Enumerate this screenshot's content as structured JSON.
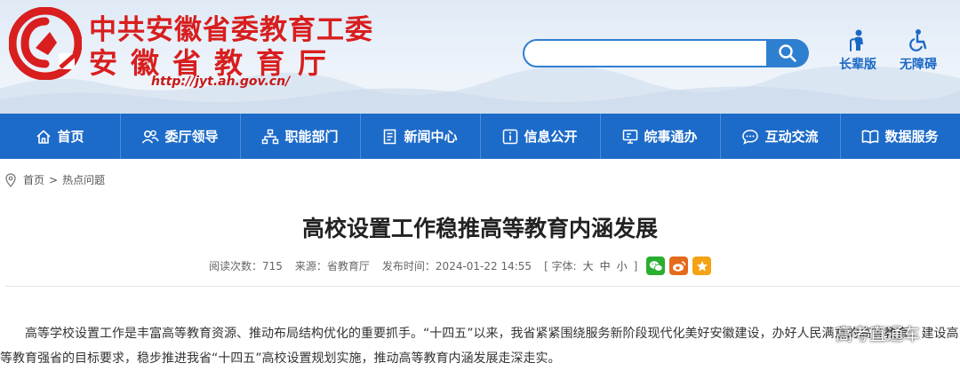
{
  "header": {
    "title_line1": "中共安徽省委教育工委",
    "title_line2": "安徽省教育厅",
    "url": "http://jyt.ah.gov.cn/",
    "search": {
      "value": "",
      "placeholder": ""
    },
    "quick_links": [
      {
        "label": "长辈版",
        "icon": "elder-person-icon"
      },
      {
        "label": "无障碍",
        "icon": "wheelchair-icon"
      }
    ],
    "colors": {
      "title_red": "#d81e1e",
      "nav_blue": "#1d6bc9"
    }
  },
  "nav": {
    "items": [
      {
        "label": "首页",
        "icon": "home-icon"
      },
      {
        "label": "委厅领导",
        "icon": "people-icon"
      },
      {
        "label": "职能部门",
        "icon": "org-chart-icon"
      },
      {
        "label": "新闻中心",
        "icon": "news-icon"
      },
      {
        "label": "信息公开",
        "icon": "info-icon"
      },
      {
        "label": "皖事通办",
        "icon": "monitor-icon"
      },
      {
        "label": "互动交流",
        "icon": "chat-icon"
      },
      {
        "label": "数据服务",
        "icon": "book-icon"
      }
    ]
  },
  "breadcrumb": {
    "home": "首页",
    "separator": ">",
    "current": "热点问题"
  },
  "article": {
    "title": "高校设置工作稳推高等教育内涵发展",
    "views": "阅读次数：715",
    "source": "来源：省教育厅",
    "published": "发布时间：2024-01-22 14:55",
    "font_size_label": "[ 字体:",
    "font_sizes": [
      "大",
      "中",
      "小"
    ],
    "font_size_close": "]",
    "share_icons": [
      "wechat-icon",
      "weibo-icon",
      "star-icon"
    ],
    "paragraph": "高等学校设置工作是丰富高等教育资源、推动布局结构优化的重要抓手。“十四五”以来，我省紧紧围绕服务新阶段现代化美好安徽建设，办好人民满意的高等教育，建设高等教育强省的目标要求，稳步推进我省“十四五”高校设置规划实施，推动高等教育内涵发展走深走实。"
  },
  "watermark": "高考直通车"
}
